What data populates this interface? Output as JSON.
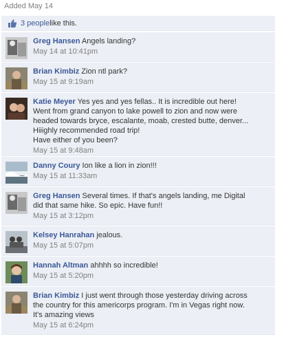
{
  "added_label": "Added May 14",
  "likes": {
    "count_text": "3 people",
    "suffix": " like this."
  },
  "comments": [
    {
      "author": "Greg Hansen",
      "lines": [
        "Angels landing?"
      ],
      "time": "May 14 at 10:41pm"
    },
    {
      "author": "Brian Kimbiz",
      "lines": [
        "Zion ntl park?"
      ],
      "time": "May 15 at 9:19am"
    },
    {
      "author": "Katie Meyer",
      "lines": [
        "Yes yes and yes fellas.. It is incredible out here!",
        "Went from grand canyon to lake powell to zion and now were",
        "headed towards bryce, escalante, moab, crested butte, denver...",
        "Hiiighly recommended road trip!",
        "Have either of you been?"
      ],
      "time": "May 15 at 9:48am"
    },
    {
      "author": "Danny Coury",
      "lines": [
        "Ion like a lion in zion!!!"
      ],
      "time": "May 15 at 11:33am"
    },
    {
      "author": "Greg Hansen",
      "lines": [
        "Several times. If that's angels landing, me Digital",
        "did that same hike. So epic. Have fun!!"
      ],
      "time": "May 15 at 3:12pm"
    },
    {
      "author": "Kelsey Hanrahan",
      "lines": [
        "jealous."
      ],
      "time": "May 15 at 5:07pm"
    },
    {
      "author": "Hannah Altman",
      "lines": [
        "ahhhh so incredible!"
      ],
      "time": "May 15 at 5:20pm"
    },
    {
      "author": "Brian Kimbiz",
      "lines": [
        "I just went through those yesterday driving across",
        "the country for this americorps program. I'm in Vegas right now.",
        "It's amazing views"
      ],
      "time": "May 15 at 6:24pm"
    }
  ]
}
